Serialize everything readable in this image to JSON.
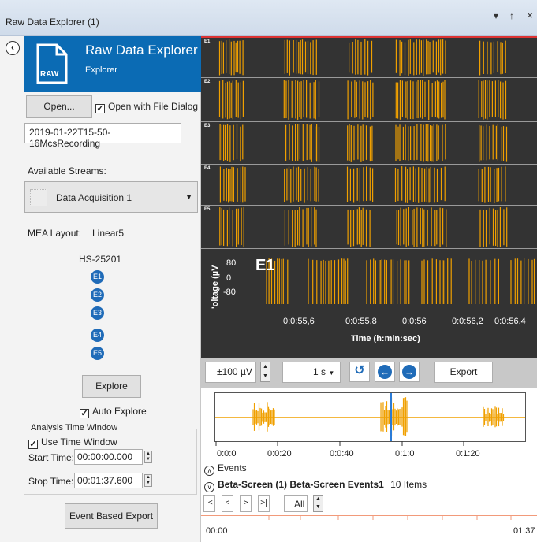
{
  "window": {
    "title": "Raw Data Explorer (1)",
    "pin_glyph": "↑",
    "dropdown_glyph": "▾",
    "close_glyph": "×"
  },
  "panel": {
    "title": "Raw Data Explorer",
    "subtitle": "Explorer",
    "icon_text": "RAW",
    "back_glyph": "‹",
    "open_label": "Open...",
    "open_dialog_label": "Open with File Dialog",
    "open_dialog_checked": true,
    "file_name": "2019-01-22T15-50-16McsRecording",
    "streams_label": "Available Streams:",
    "stream_selected": "Data Acquisition 1",
    "mea_layout_label": "MEA Layout:",
    "mea_layout_value": "Linear5",
    "headstage": "HS-25201",
    "electrodes": [
      "E1",
      "E2",
      "E3",
      "E4",
      "E5"
    ],
    "explore_label": "Explore",
    "auto_explore_label": "Auto Explore",
    "auto_explore_checked": true,
    "analysis_window_label": "Analysis Time Window",
    "use_time_window_label": "Use Time Window",
    "use_time_window_checked": true,
    "start_time_label": "Start Time:",
    "start_time_value": "00:00:00.000",
    "stop_time_label": "Stop Time:",
    "stop_time_value": "00:01:37.600",
    "event_export_label": "Event Based Export"
  },
  "channels": [
    "E1",
    "E2",
    "E3",
    "E4",
    "E5"
  ],
  "detail": {
    "channel": "E1",
    "ylabel": "Voltage (µV)",
    "ylabel_visible": "'oltage (µV",
    "yticks": [
      "80",
      "0",
      "-80"
    ],
    "xticks": [
      "0:0:55,6",
      "0:0:55,8",
      "0:0:56",
      "0:0:56,2",
      "0:0:56,4"
    ],
    "xlabel": "Time (h:min:sec)"
  },
  "toolbar": {
    "range_value": "±100 µV",
    "time_value": "1 s",
    "export_label": "Export",
    "undo_glyph": "↺",
    "back_glyph": "←",
    "forward_glyph": "→"
  },
  "overview": {
    "xticks": [
      "0:0:0",
      "0:0:20",
      "0:0:40",
      "0:1:0",
      "0:1:20"
    ],
    "marker_value": "0:0:56"
  },
  "events": {
    "header": "Events",
    "stream": "Beta-Screen (1) Beta-Screen Events1",
    "count": "10 Items",
    "nav_first": "|<",
    "nav_prev": "<",
    "nav_next": ">",
    "nav_last": ">|",
    "filter_value": "All",
    "start": "00:00",
    "end": "01:37"
  },
  "colors": {
    "trace": "#f0a000",
    "accent": "#0b6bb4",
    "marker": "#2b7bd6",
    "timeline": "#f29a7a"
  }
}
